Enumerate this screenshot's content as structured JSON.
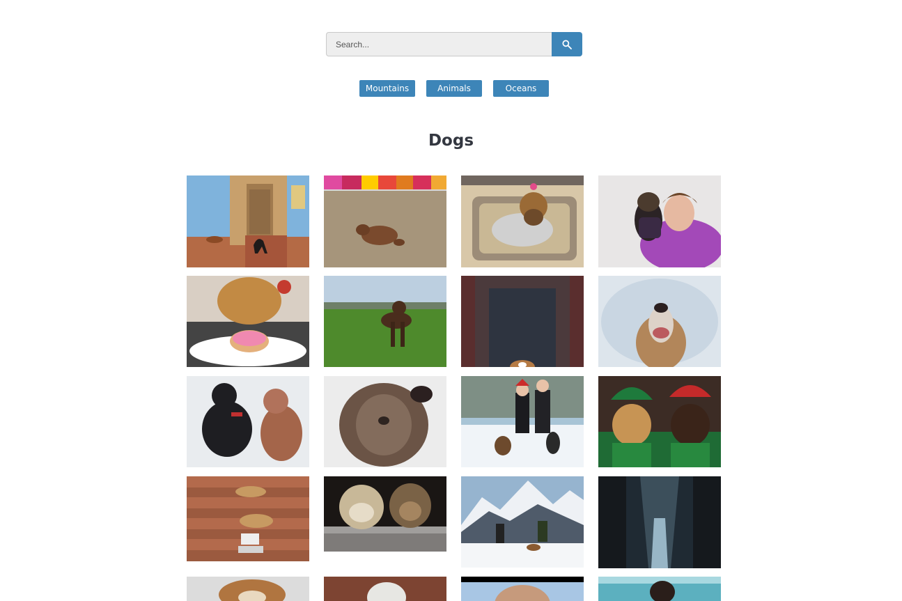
{
  "search": {
    "placeholder": "Search...",
    "icon": "search-icon"
  },
  "categories": [
    {
      "label": "Mountains"
    },
    {
      "label": "Animals"
    },
    {
      "label": "Oceans"
    }
  ],
  "heading": "Dogs",
  "colors": {
    "accent": "#3d85b8",
    "heading": "#333740",
    "input_bg": "#eeeeee"
  },
  "photos": [
    {
      "subject": "dogs by blue wall and carved door"
    },
    {
      "subject": "dog sleeping on street by colorful fabric"
    },
    {
      "subject": "yorkshire terrier in sweater on bed"
    },
    {
      "subject": "girl hugging dachshund in snow"
    },
    {
      "subject": "golden retriever eating donut"
    },
    {
      "subject": "chocolate labrador in field"
    },
    {
      "subject": "beagle peeking behind wall"
    },
    {
      "subject": "dog looking up in snow"
    },
    {
      "subject": "two poodles in snow"
    },
    {
      "subject": "shaggy dog close-up"
    },
    {
      "subject": "couple walking dogs in snow"
    },
    {
      "subject": "dachshunds in christmas costumes"
    },
    {
      "subject": "dogs sleeping on brick steps"
    },
    {
      "subject": "two terriers on ledge"
    },
    {
      "subject": "hikers with dogs on snowy mountain"
    },
    {
      "subject": "misty tree-lined road"
    },
    {
      "subject": "dog in snow"
    },
    {
      "subject": "dog in knit hat"
    },
    {
      "subject": "bald head close-up"
    },
    {
      "subject": "dog at beach"
    }
  ]
}
